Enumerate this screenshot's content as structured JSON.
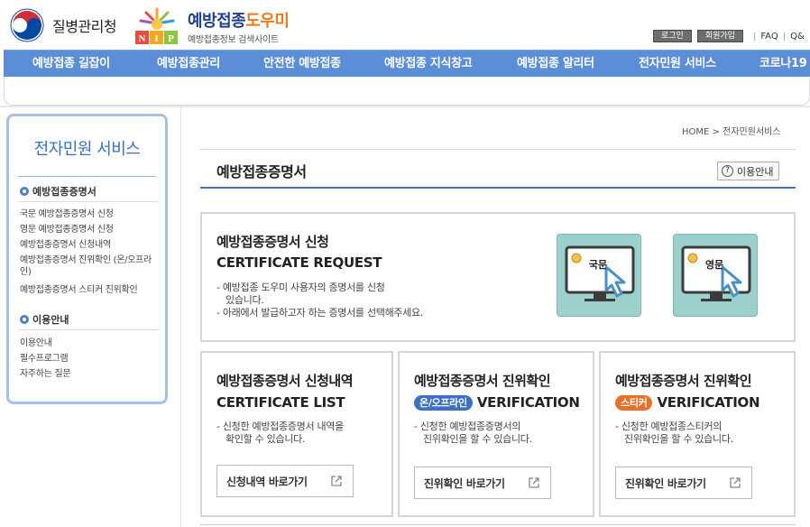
{
  "header": {
    "agency_name": "질병관리청",
    "site_title_main": "예방접종",
    "site_title_accent": "도우미",
    "site_subtitle": "예방접종정보 검색사이트",
    "nip_letters": "NIP",
    "util": {
      "login": "로그인",
      "join": "회원가입",
      "faq": "FAQ",
      "qa": "Q&"
    }
  },
  "nav": {
    "items": [
      "예방접종 길잡이",
      "예방접종관리",
      "안전한 예방접종",
      "예방접종 지식창고",
      "예방접종 알리터",
      "전자민원 서비스",
      "코로나19"
    ]
  },
  "sidebar": {
    "title": "전자민원 서비스",
    "section1": {
      "title": "예방접종증명서",
      "links": [
        "국문 예방접종증명서 신청",
        "영문 예방접종증명서 신청",
        "예방접종증명서 신청내역",
        "예방접종증명서 진위확인 (온/오프라인)",
        "예방접종증명서 스티커 진위확인"
      ]
    },
    "section2": {
      "title": "이용안내",
      "links": [
        "이용안내",
        "필수프로그램",
        "자주하는 질문"
      ]
    }
  },
  "breadcrumb": {
    "home": "HOME",
    "separator": ">",
    "current": "전자민원서비스"
  },
  "page": {
    "title": "예방접종증명서",
    "help_label": "이용안내"
  },
  "request_card": {
    "title": "예방접종증명서 신청",
    "subtitle": "CERTIFICATE REQUEST",
    "desc1": "- 예방접종 도우미 사용자의 증명서를 신청",
    "desc1b": "있습니다.",
    "desc2": "- 아래에서 발급하고자 하는 증명서를 선택해주세요.",
    "tiles": [
      {
        "label": "국문"
      },
      {
        "label": "영문"
      }
    ]
  },
  "cards": [
    {
      "title": "예방접종증명서 신청내역",
      "subtitle": "CERTIFICATE LIST",
      "tag": "",
      "desc1": "- 신청한 예방접종증명서 내역을",
      "desc2": "확인할 수 있습니다.",
      "button": "신청내역 바로가기"
    },
    {
      "title": "예방접종증명서 진위확인",
      "subtitle": "VERIFICATION",
      "tag": "온/오프라인",
      "desc1": "- 신청한 예방접종증명서의",
      "desc2": "진위확인을 할 수 있습니다.",
      "button": "진위확인 바로가기"
    },
    {
      "title": "예방접종증명서 진위확인",
      "subtitle": "VERIFICATION",
      "tag": "스티커",
      "desc1": "- 신청한 예방접종스티커의",
      "desc2": "진위확인을 할 수 있습니다.",
      "button": "진위확인 바로가기"
    }
  ],
  "colors": {
    "nav": "#5b8ed6",
    "tag_online": "#3d6fc6",
    "tag_sticker": "#e8712a",
    "tile": "#9cd0cc",
    "accent_orange": "#f07a1a"
  }
}
